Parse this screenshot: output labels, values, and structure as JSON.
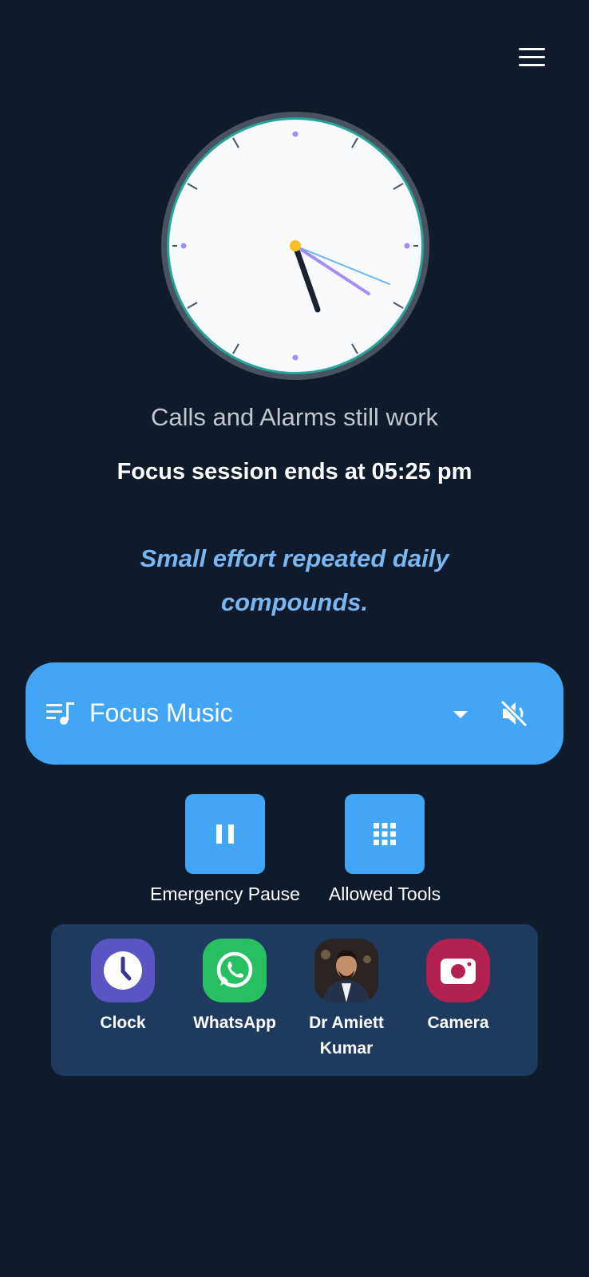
{
  "header": {
    "menu_icon": "hamburger-menu-icon"
  },
  "clock": {
    "face_color": "#f8fafc",
    "ring_color": "#26a69a",
    "hour_hand_color": "#1a2230",
    "minute_hand_color": "#a78bfa",
    "second_hand_color": "#64b5f6",
    "center_dot_color": "#fbbf24"
  },
  "status": {
    "calls_text": "Calls and Alarms still work",
    "session_text": "Focus session ends at 05:25 pm"
  },
  "quote": {
    "line1": "Small effort repeated daily",
    "line2": "compounds."
  },
  "music": {
    "label": "Focus Music",
    "icons": {
      "queue": "queue-music-icon",
      "dropdown": "arrow-drop-down-icon",
      "mute": "volume-off-icon"
    }
  },
  "actions": {
    "pause_label": "Emergency Pause",
    "tools_label": "Allowed Tools",
    "icons": {
      "pause": "pause-icon",
      "tools": "grid-apps-icon"
    }
  },
  "apps": [
    {
      "label": "Clock",
      "line2": "",
      "icon": "clock-app-icon",
      "color": "#5b54c4"
    },
    {
      "label": "WhatsApp",
      "line2": "",
      "icon": "whatsapp-icon",
      "color": "#27c061"
    },
    {
      "label": "Dr Amiett",
      "line2": "Kumar",
      "icon": "contact-avatar",
      "color": "#1f1a18"
    },
    {
      "label": "Camera",
      "line2": "",
      "icon": "camera-app-icon",
      "color": "#b2214f"
    }
  ],
  "colors": {
    "background": "#0f1a2b",
    "accent": "#42a5f5",
    "quote": "#79b7f3",
    "apps_panel": "#1e3a5f"
  }
}
